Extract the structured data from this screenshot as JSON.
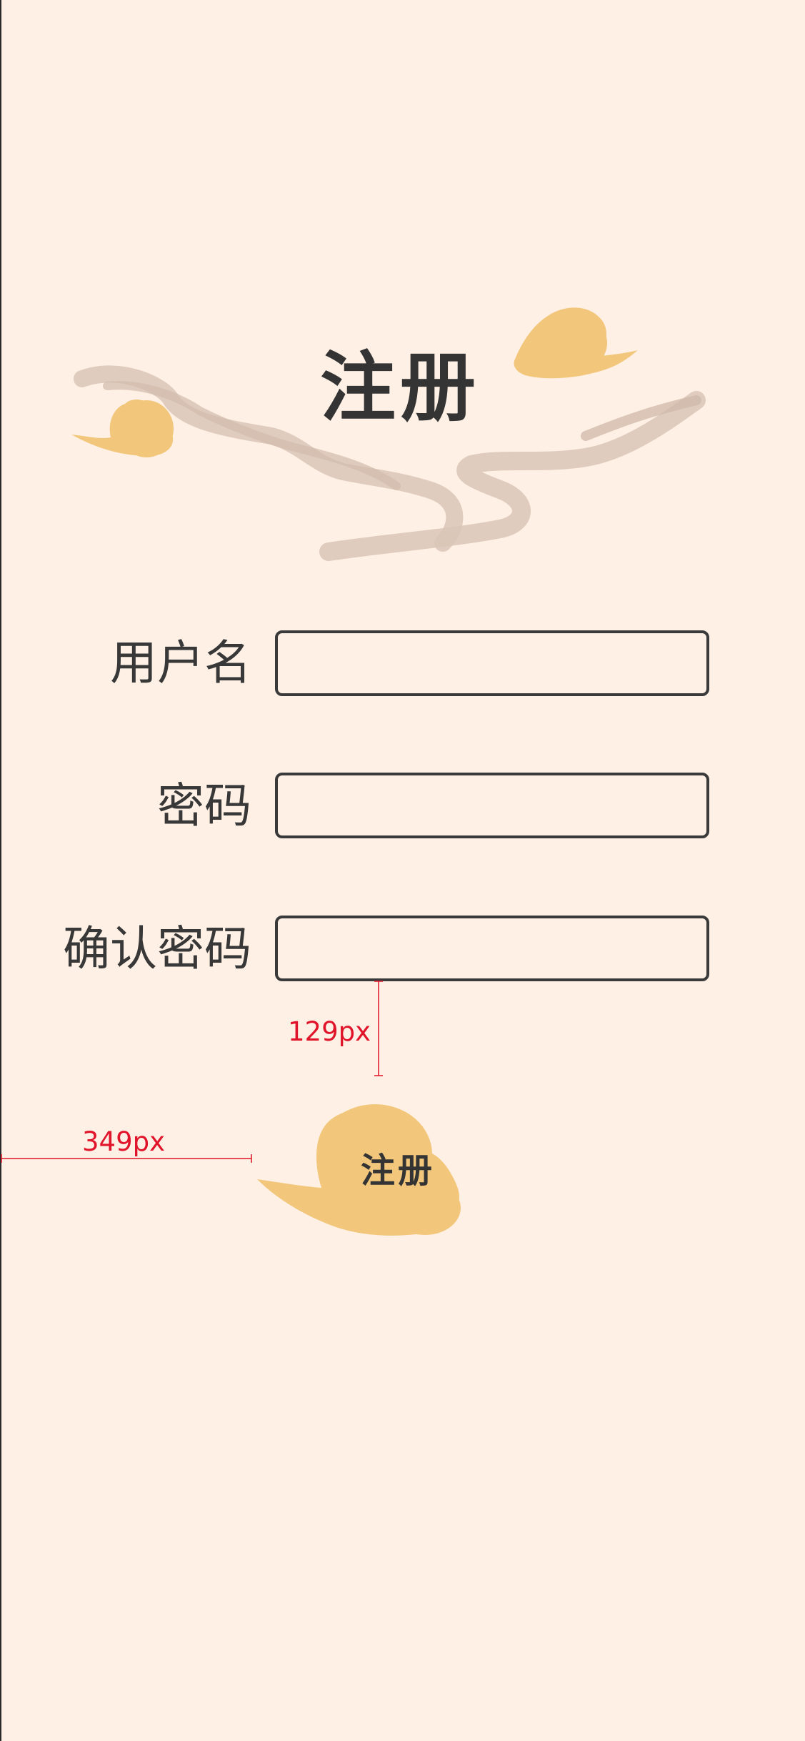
{
  "page": {
    "title": "注册",
    "background_color": "#FEF0E4",
    "cloud_color": "#F2C77C",
    "smoke_color": "#D9C5B7"
  },
  "form": {
    "fields": [
      {
        "label": "用户名",
        "value": ""
      },
      {
        "label": "密码",
        "value": ""
      },
      {
        "label": "确认密码",
        "value": ""
      }
    ],
    "submit_label": "注册"
  },
  "annotations": {
    "vertical_gap_label": "129px",
    "horizontal_offset_label": "349px",
    "annotation_color": "#E0142A"
  }
}
